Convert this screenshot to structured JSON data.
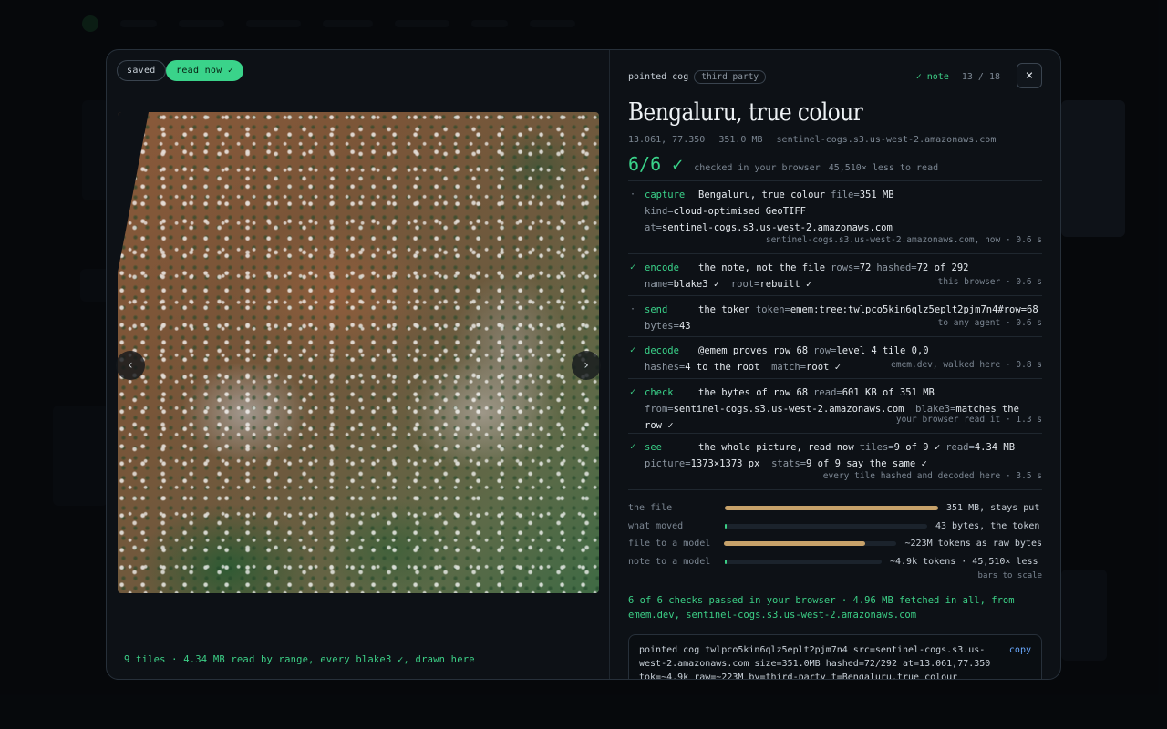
{
  "modal": {
    "chips": {
      "saved": "saved",
      "read_now": "read now ✓"
    },
    "left_footer": "9 tiles · 4.34 MB read by range, every blake3 ✓, drawn here",
    "nav": {
      "prev": "‹",
      "next": "›"
    }
  },
  "header": {
    "kind": "pointed cog",
    "tag": "third party",
    "note": "✓ note",
    "page": "13 / 18",
    "close": "×"
  },
  "title": "Bengaluru, true colour",
  "meta": {
    "coords": "13.061, 77.350",
    "size": "351.0 MB",
    "host": "sentinel-cogs.s3.us-west-2.amazonaws.com"
  },
  "score": {
    "value": "6/6 ✓",
    "label": "checked in your browser",
    "ratio": "45,510× less to read"
  },
  "steps": [
    {
      "mark": "·",
      "name": "capture",
      "what": "Bengaluru, true colour",
      "l1kv": "file=",
      "l1v": "351 MB",
      "l2": "kind=",
      "l2v": "cloud-optimised GeoTIFF",
      "l3": "at=",
      "l3v": "sentinel-cogs.s3.us-west-2.amazonaws.com",
      "where": "sentinel-cogs.s3.us-west-2.amazonaws.com, now · 0.6 s"
    },
    {
      "mark": "✓",
      "name": "encode",
      "what": "the note, not the file",
      "l1kv": "rows=",
      "l1v": "72",
      "l1kv_b": "hashed=",
      "l1v_b": "72 of 292",
      "l2": "name=",
      "l2v": "blake3 ✓",
      "l2b": "root=",
      "l2bv": "rebuilt ✓",
      "where": "this browser · 0.6 s"
    },
    {
      "mark": "·",
      "name": "send",
      "what": "the token",
      "l1kv": "token=",
      "l1v": "emem:tree:twlpco5kin6qlz5eplt2pjm7n4#row=68",
      "l2": "bytes=",
      "l2v": "43",
      "where": "to any agent · 0.6 s"
    },
    {
      "mark": "✓",
      "name": "decode",
      "what": "@emem proves row 68",
      "l1kv": "row=",
      "l1v": "level 4 tile 0,0",
      "l2": "hashes=",
      "l2v": "4 to the root",
      "l2b": "match=",
      "l2bv": "root ✓",
      "where": "emem.dev, walked here · 0.8 s"
    },
    {
      "mark": "✓",
      "name": "check",
      "what": "the bytes of row 68",
      "l1kv": "read=",
      "l1v": "601 KB of 351 MB",
      "l2": "from=",
      "l2v": "sentinel-cogs.s3.us-west-2.amazonaws.com",
      "l2b": "blake3=",
      "l2bv": "matches the row ✓",
      "where": "your browser read it · 1.3 s"
    },
    {
      "mark": "✓",
      "name": "see",
      "what": "the whole picture, read now",
      "l1kv": "tiles=",
      "l1v": "9 of 9 ✓",
      "l1kv_b": "read=",
      "l1v_b": "4.34 MB",
      "l2": "picture=",
      "l2v": "1373×1373 px",
      "l2b": "stats=",
      "l2bv": "9 of 9 say the same ✓",
      "where": "every tile hashed and decoded here · 3.5 s"
    }
  ],
  "bars": [
    {
      "label": "the file",
      "value": "351 MB, stays put",
      "fraction": 1.0,
      "color": "#c7a26a"
    },
    {
      "label": "what moved",
      "value": "43 bytes, the token",
      "fraction": 0.004,
      "color": "#3ccf86"
    },
    {
      "label": "file to a model",
      "value": "~223M tokens as raw bytes",
      "fraction": 0.82,
      "color": "#c7a26a"
    },
    {
      "label": "note to a model",
      "value": "~4.9k tokens · 45,510× less",
      "fraction": 0.006,
      "color": "#3ccf86"
    }
  ],
  "bars_note": "bars to scale",
  "summary": "6 of 6 checks passed in your browser · 4.96 MB fetched in all, from emem.dev, sentinel-cogs.s3.us-west-2.amazonaws.com",
  "code": {
    "text": "pointed cog twlpco5kin6qlz5eplt2pjm7n4 src=sentinel-cogs.s3.us-west-2.amazonaws.com size=351.0MB hashed=72/292 at=13.061,77.350 tok=~4.9k raw=~223M by=third-party t=Bengaluru,true_colour",
    "copy": "copy"
  },
  "colors": {
    "accent": "#3ad38a",
    "gold": "#c7a26a",
    "link": "#6aa9ff"
  }
}
